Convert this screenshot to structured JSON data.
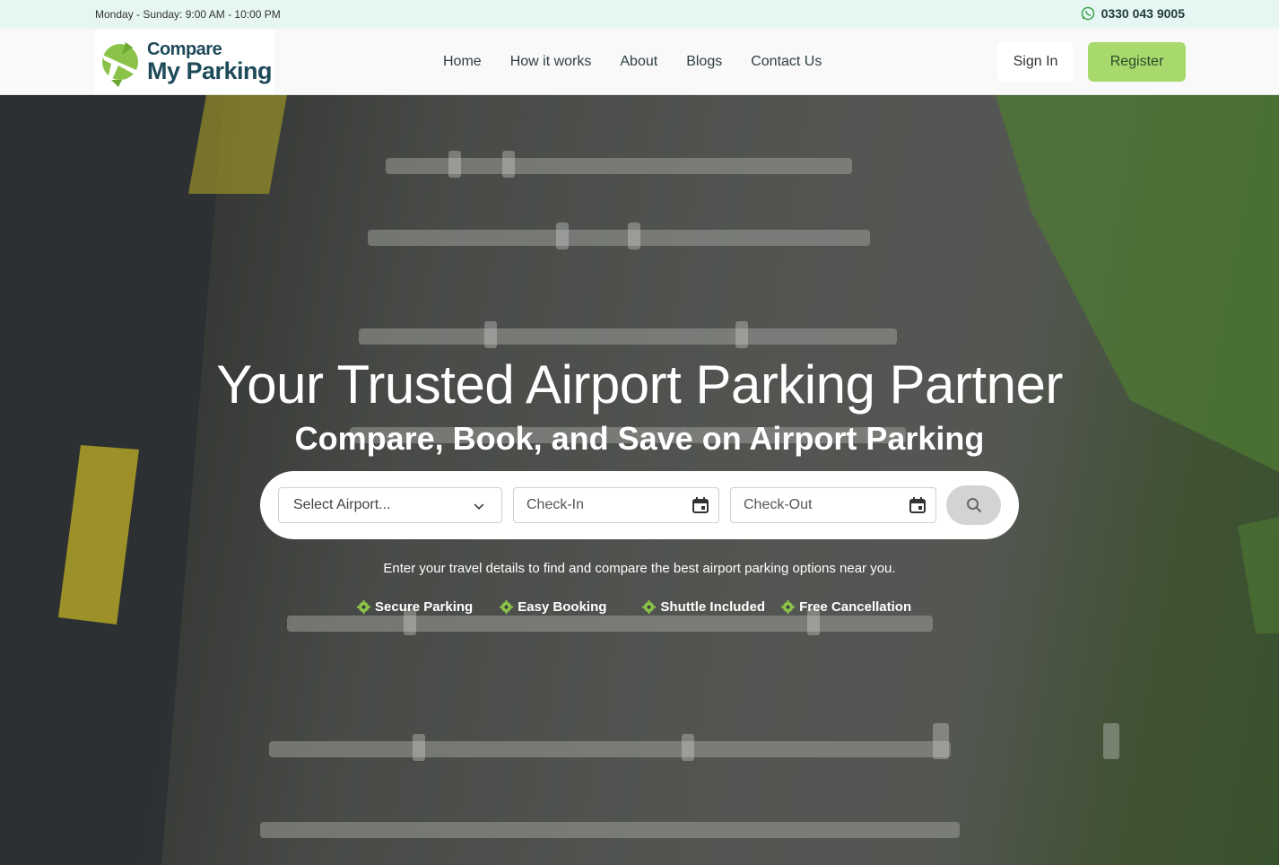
{
  "topbar": {
    "hours": "Monday - Sunday: 9:00 AM - 10:00 PM",
    "phone": "0330 043 9005"
  },
  "logo": {
    "line1": "Compare",
    "line2": "My Parking"
  },
  "nav": [
    "Home",
    "How it works",
    "About",
    "Blogs",
    "Contact Us"
  ],
  "auth": {
    "signin": "Sign In",
    "register": "Register"
  },
  "hero": {
    "title": "Your Trusted Airport Parking Partner",
    "subtitle": "Compare, Book, and Save on Airport Parking",
    "hint": "Enter your travel details to find and compare the best airport parking options near you."
  },
  "search": {
    "airport_placeholder": "Select Airport...",
    "checkin_placeholder": "Check-In",
    "checkout_placeholder": "Check-Out"
  },
  "features": [
    "Secure Parking",
    "Easy Booking",
    "Shuttle Included",
    "Free Cancellation"
  ],
  "colors": {
    "accent": "#a8d96d",
    "brand": "#1f4a5a",
    "topbar_bg": "#e6f7f3",
    "feature_icon": "#8bc34a"
  },
  "icons": {
    "phone": "whatsapp-icon",
    "select": "chevron-down-icon",
    "date": "calendar-icon",
    "search": "search-icon",
    "feature": "gear-icon"
  }
}
